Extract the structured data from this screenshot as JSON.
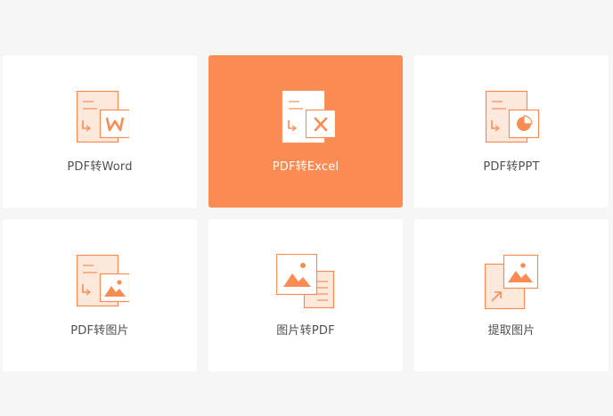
{
  "tools": [
    {
      "label": "PDF转Word",
      "icon": "pdf-to-word-icon"
    },
    {
      "label": "PDF转Excel",
      "icon": "pdf-to-excel-icon",
      "selected": true
    },
    {
      "label": "PDF转PPT",
      "icon": "pdf-to-ppt-icon"
    },
    {
      "label": "PDF转图片",
      "icon": "pdf-to-image-icon"
    },
    {
      "label": "图片转PDF",
      "icon": "image-to-pdf-icon"
    },
    {
      "label": "提取图片",
      "icon": "extract-image-icon"
    }
  ],
  "colors": {
    "accent": "#fa8b52",
    "accent_light": "#fde8dc",
    "page_background": "#f6f6f6",
    "card_background": "#ffffff",
    "label": "#505050",
    "label_selected": "#ffffff"
  }
}
